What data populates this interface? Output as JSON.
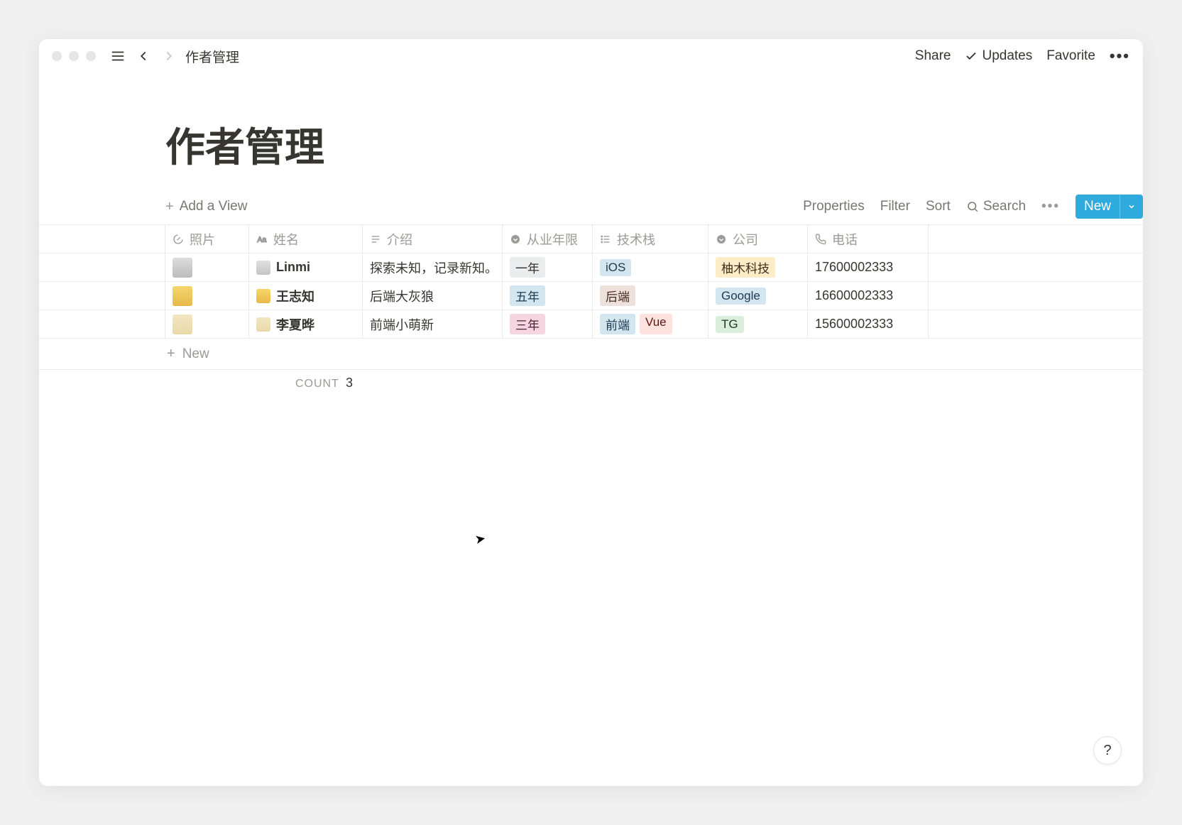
{
  "breadcrumb": "作者管理",
  "topbar": {
    "share": "Share",
    "updates": "Updates",
    "favorite": "Favorite"
  },
  "page_title": "作者管理",
  "toolbar": {
    "add_view": "Add a View",
    "properties": "Properties",
    "filter": "Filter",
    "sort": "Sort",
    "search": "Search",
    "new": "New"
  },
  "columns": {
    "photo": "照片",
    "name": "姓名",
    "intro": "介绍",
    "years": "从业年限",
    "stack": "技术栈",
    "company": "公司",
    "phone": "电话"
  },
  "rows": [
    {
      "name": "Linmi",
      "intro": "探索未知，记录新知。",
      "years": {
        "label": "一年",
        "color": "gray"
      },
      "stack": [
        {
          "label": "iOS",
          "color": "blue"
        }
      ],
      "company": {
        "label": "柚木科技",
        "color": "yellow"
      },
      "phone": "17600002333"
    },
    {
      "name": "王志知",
      "intro": "后端大灰狼",
      "years": {
        "label": "五年",
        "color": "bluelt"
      },
      "stack": [
        {
          "label": "后端",
          "color": "brown"
        }
      ],
      "company": {
        "label": "Google",
        "color": "blue"
      },
      "phone": "16600002333"
    },
    {
      "name": "李夏晔",
      "intro": "前端小萌新",
      "years": {
        "label": "三年",
        "color": "pink"
      },
      "stack": [
        {
          "label": "前端",
          "color": "blue"
        },
        {
          "label": "Vue",
          "color": "red"
        }
      ],
      "company": {
        "label": "TG",
        "color": "green"
      },
      "phone": "15600002333"
    }
  ],
  "new_row": "New",
  "footer": {
    "label": "COUNT",
    "value": "3"
  },
  "help": "?"
}
